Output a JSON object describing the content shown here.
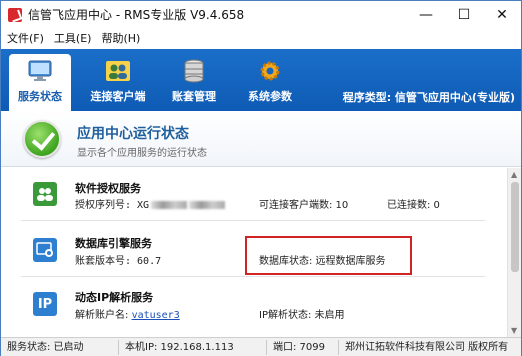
{
  "window": {
    "title": "信管飞应用中心 - RMS专业版 V9.4.658",
    "minimize": "—",
    "maximize": "☐",
    "close": "✕"
  },
  "menu": [
    {
      "label": "文件(F)"
    },
    {
      "label": "工具(E)"
    },
    {
      "label": "帮助(H)"
    }
  ],
  "toolbar": {
    "tabs": [
      {
        "label": "服务状态",
        "icon": "monitor-icon"
      },
      {
        "label": "连接客户端",
        "icon": "users-icon"
      },
      {
        "label": "账套管理",
        "icon": "database-icon"
      },
      {
        "label": "系统参数",
        "icon": "gear-icon"
      }
    ],
    "program_type": "程序类型: 信管飞应用中心(专业版)"
  },
  "header": {
    "title": "应用中心运行状态",
    "subtitle": "显示各个应用服务的运行状态"
  },
  "services": {
    "license": {
      "name": "软件授权服务",
      "serial": "授权序列号: XG",
      "max_clients": "可连接客户端数: 10",
      "connected": "已连接数:  0"
    },
    "database": {
      "name": "数据库引擎服务",
      "version": "账套版本号: 60.7",
      "status": "数据库状态: 远程数据库服务"
    },
    "ip": {
      "name": "动态IP解析服务",
      "account_label": "解析账户名:",
      "account_value": "vatuser3",
      "status": "IP解析状态: 未启用"
    }
  },
  "statusbar": {
    "service": "服务状态: 已启动",
    "ip": "本机IP: 192.168.1.113",
    "port": "端口: 7099",
    "copyright": "郑州讧拓软件科技有限公司 版权所有"
  },
  "colors": {
    "toolbar_blue": "#1565c0",
    "accent_red": "#d02424",
    "ok_green": "#3ea41e"
  }
}
